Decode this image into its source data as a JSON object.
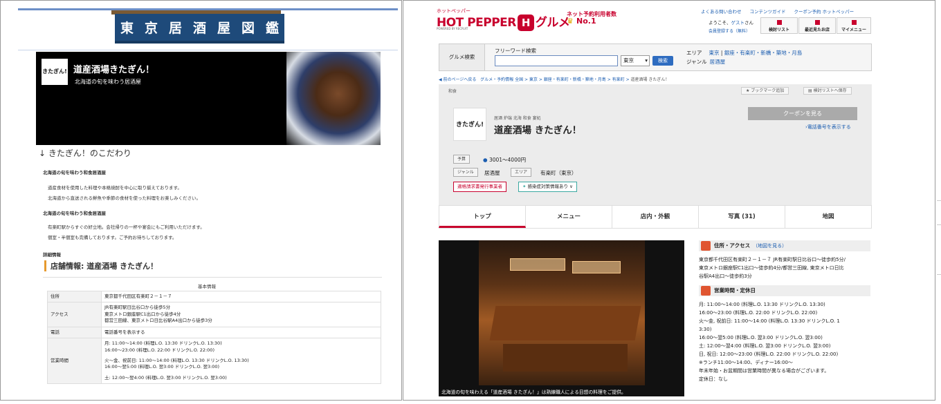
{
  "left": {
    "noren": [
      "東",
      "京",
      "居",
      "酒",
      "屋",
      "図",
      "鑑"
    ],
    "hero": {
      "logo": "きたぎん!",
      "title": "道産酒場きたぎん！",
      "subtitle": "北海道の旬を味わう居酒屋"
    },
    "section_heading": "きたぎん！のこだわり",
    "p1_heading": "北海道の旬を味わう和食居酒屋",
    "p1_lines": [
      "道産食材を使用した料理や本格焼酎を中心に取り揃えております。",
      "北海道から直送される鮮魚や季節の食材を使った料理をお楽しみください。"
    ],
    "p2_heading": "北海道の旬を味わう和食居酒屋",
    "p2_lines": [
      "有楽町駅からすぐの好立地。会社帰りの一杯や宴会にもご利用いただけます。",
      "個室・半個室も完備しております。ご予約お待ちしております。"
    ],
    "detail_label": "詳細情報",
    "shop_info_title": "店舗情報: 道産酒場 きたぎん！",
    "table_caption": "基本情報",
    "table": [
      {
        "k": "住所",
        "v": [
          "東京都千代田区有楽町２－１－７"
        ]
      },
      {
        "k": "アクセス",
        "v": [
          "JR有楽町駅日比谷口から徒歩5分",
          "東京メトロ銀座駅C1出口から徒歩4分",
          "都営三田線、東京メトロ日比谷駅A4出口から徒歩3分"
        ]
      },
      {
        "k": "電話",
        "v": [
          "電話番号を表示する"
        ]
      },
      {
        "k": "営業時間",
        "v": [
          "月: 11:00〜14:00 (料理L.O. 13:30 ドリンクL.O. 13:30)",
          "16:00〜23:00 (料理L.O. 22:00 ドリンクL.O. 22:00)",
          "火〜金、祝前日: 11:00〜14:00 (料理L.O. 13:30 ドリンクL.O. 13:30)",
          "16:00〜翌5:00 (料理L.O. 翌3:00 ドリンクL.O. 翌3:00)",
          "土: 12:00〜翌4:00 (料理L.O. 翌3:00 ドリンクL.O. 翌3:00)"
        ]
      }
    ]
  },
  "right": {
    "logo_small": "ホットペッパー",
    "logo_a": "HOT PEPPER",
    "logo_icon": "H",
    "logo_b": "グルメ",
    "logo_sub": "POWERED BY RECRUIT",
    "no1_a": "ネット予約利用者数",
    "no1_b": "No.1",
    "top_links": [
      "よくある問い合わせ",
      "コンテンツガイド",
      "クーポン予約 ホットペッパー"
    ],
    "greeting": "ようこそ、",
    "guest": "ゲスト",
    "greeting_end": "さん",
    "register": "会員登録する（無料）",
    "top_buttons": [
      "検討リスト",
      "最近見たお店",
      "マイメニュー"
    ],
    "search": {
      "label": "グルメ検索",
      "freeword": "フリーワード検索",
      "select": "東京",
      "button": "検索",
      "area_label": "エリア",
      "area_links": [
        "東京",
        "銀座・有楽町・新橋・築地・月島"
      ],
      "genre_label": "ジャンル",
      "genre_link": "居酒屋"
    },
    "breadcrumb": [
      "前のページへ戻る",
      "グルメ・予約情報 全国",
      "東京",
      "銀座・有楽町・新橋・築地・月島",
      "有楽町",
      "道産酒場 きたぎん！"
    ],
    "category_tag": "和食",
    "bookmark": "ブックマーク追加",
    "add_list": "検討リストへ保存",
    "shop_logo": "きたぎん!",
    "shop_small": "居酒 炉端 北海 和食 宴処",
    "shop_name": "道産酒場 きたぎん！",
    "coupon_button": "クーポンを見る",
    "phone_link": "電話番号を表示する",
    "budget_label": "予算",
    "budget_value": "3001〜4000円",
    "genre_label": "ジャンル",
    "genre_value": "居酒屋",
    "area_label": "エリア",
    "area_value": "有楽町（東京）",
    "invoice": "適格請求書発行事業者",
    "infection": "感染症対策情報あり",
    "tabs": [
      "トップ",
      "メニュー",
      "店内・外観",
      "写真 (31)",
      "地図"
    ],
    "photo_caption": "北海道の旬を味わえる「道産酒場 きたぎん！」は熟練職人による目想の料理をご提供。",
    "access_head": "住所・アクセス",
    "access_map": "（地図を見る）",
    "access_text": "東京都千代田区有楽町２－１－７ JR有楽町駅日比谷口〜徒歩約5分/\n東京メトロ銀座駅C1出口〜徒歩約4分/都営三田線, 東京メトロ日比\n谷駅A4出口〜徒歩約3分",
    "hours_head": "営業時間・定休日",
    "hours_text": "月: 11:00〜14:00 (料理L.O. 13:30 ドリンクL.O. 13:30)\n16:00〜23:00 (料理L.O. 22:00 ドリンクL.O. 22:00)\n火〜金, 祝前日: 11:00〜14:00 (料理L.O. 13:30 ドリンクL.O. 1\n3:30)\n16:00〜翌5:00 (料理L.O. 翌3:00 ドリンクL.O. 翌3:00)\n土: 12:00〜翌4:00 (料理L.O. 翌3:00 ドリンクL.O. 翌3:00)\n日, 祝日: 12:00〜23:00 (料理L.O. 22:00 ドリンクL.O. 22:00)\n※ランチ11:00〜14:00、ディナー16:00〜\n年末年始・お盆期間は営業時間が異なる場合がございます。",
    "closed": "定休日：なし"
  },
  "colors": {
    "brand_red": "#c8002d",
    "link_blue": "#1b5db0",
    "noren_blue": "#1e4a7a",
    "accent_orange": "#e69a2e"
  }
}
